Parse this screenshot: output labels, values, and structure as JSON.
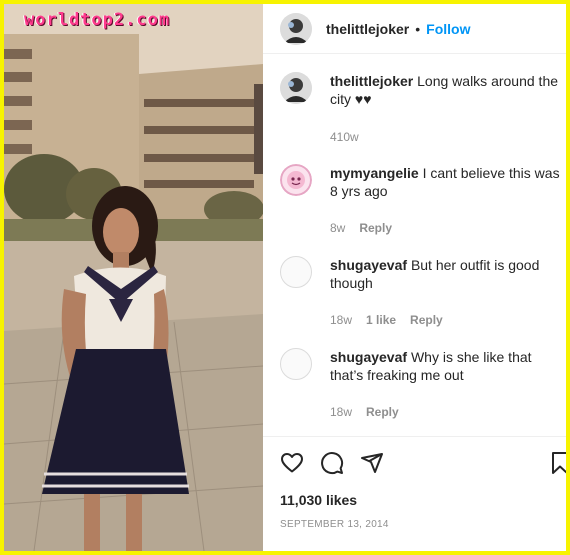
{
  "watermark": "worldtop2.com",
  "post": {
    "username": "thelittlejoker",
    "dot": "•",
    "follow_label": "Follow"
  },
  "caption": {
    "username": "thelittlejoker",
    "text": "Long walks around the city ♥♥",
    "time": "410w"
  },
  "comments": [
    {
      "username": "mymyangelie",
      "text": "I cant believe this was 8 yrs ago",
      "time": "8w",
      "likes": "",
      "reply": "Reply"
    },
    {
      "username": "shugayevaf",
      "text": "But her outfit is good though",
      "time": "18w",
      "likes": "1 like",
      "reply": "Reply"
    },
    {
      "username": "shugayevaf",
      "text": "Why is she like that that’s freaking me out",
      "time": "18w",
      "likes": "",
      "reply": "Reply"
    }
  ],
  "actions": {
    "icons": [
      "heart-icon",
      "comment-icon",
      "share-icon",
      "bookmark-icon"
    ],
    "likes": "11,030 likes",
    "date": "SEPTEMBER 13, 2014"
  },
  "colors": {
    "accent": "#0095f6",
    "frame": "#f7f300",
    "muted": "#8e8e8e"
  }
}
